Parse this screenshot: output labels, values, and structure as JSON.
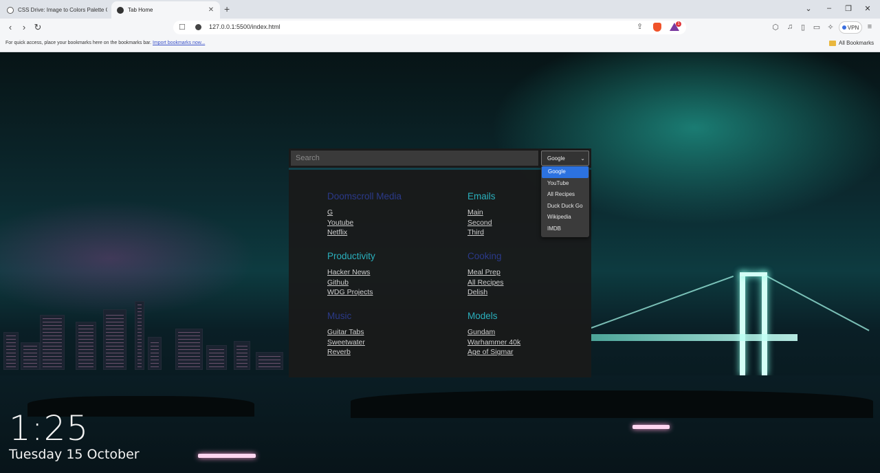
{
  "browser": {
    "tabs": [
      {
        "title": "CSS Drive: Image to Colors Palette G",
        "active": false
      },
      {
        "title": "Tab Home",
        "active": true
      }
    ],
    "new_tab": "+",
    "window_controls": {
      "minimize": "⌄",
      "restore": "–",
      "maximize": "❐",
      "close": "✕"
    },
    "url": "127.0.0.1:5500/index.html",
    "rewards_badge": "1",
    "vpn_label": "VPN",
    "bookmarks_hint": "For quick access, place your bookmarks here on the bookmarks bar.",
    "bookmarks_import": "Import bookmarks now...",
    "all_bookmarks": "All Bookmarks"
  },
  "search": {
    "placeholder": "Search",
    "selected_engine": "Google",
    "engines": [
      "Google",
      "YouTube",
      "All Recipes",
      "Duck Duck Go",
      "Wikipedia",
      "IMDB"
    ]
  },
  "groups": [
    {
      "title": "Doomscroll Media",
      "color": "#2b3a8a",
      "links": [
        "G",
        "Youtube",
        "Netflix"
      ]
    },
    {
      "title": "Emails",
      "color": "#2ab0bd",
      "links": [
        "Main",
        "Second",
        "Third"
      ]
    },
    {
      "title": "Productivity",
      "color": "#2ab0bd",
      "links": [
        "Hacker News",
        "Github",
        "WDG Projects"
      ]
    },
    {
      "title": "Cooking",
      "color": "#2b3a8a",
      "links": [
        "Meal Prep",
        "All Recipes",
        "Delish"
      ]
    },
    {
      "title": "Music",
      "color": "#2b3a8a",
      "links": [
        "Guitar Tabs",
        "Sweetwater",
        "Reverb"
      ]
    },
    {
      "title": "Models",
      "color": "#2ab0bd",
      "links": [
        "Gundam",
        "Warhammer 40k",
        "Age of Sigmar"
      ]
    }
  ],
  "clock": {
    "time": "1:25",
    "date": "Tuesday 15 October"
  }
}
